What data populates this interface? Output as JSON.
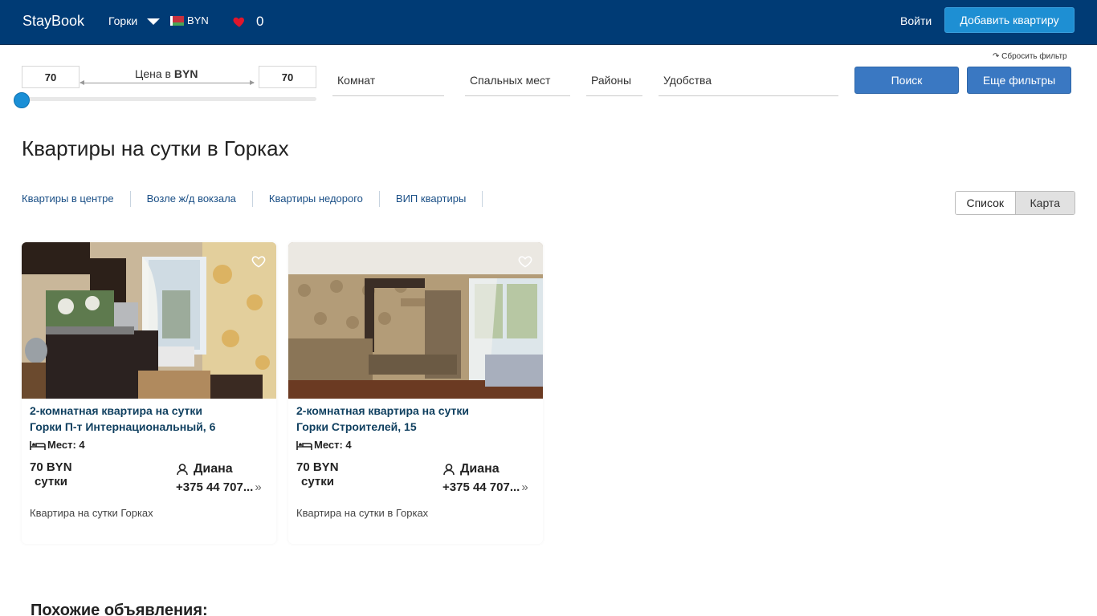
{
  "header": {
    "brand": "StayBook",
    "city": "Горки",
    "currency": "BYN",
    "favorites_count": "0",
    "login": "Войти",
    "add_button": "Добавить квартиру",
    "colors": {
      "bar": "#003b75",
      "accent": "#1e8fd3",
      "heart": "#e0162b"
    }
  },
  "filters": {
    "reset": "Сбросить фильтр",
    "price_min": "70",
    "price_max": "70",
    "price_label_prefix": "Цена в",
    "price_label_currency": "BYN",
    "slider_position": 0,
    "rooms": "Комнат",
    "beds": "Спальных мест",
    "districts": "Районы",
    "amenities": "Удобства",
    "search_button": "Поиск",
    "more_filters_button": "Еще фильтры"
  },
  "page": {
    "title": "Квартиры на сутки в Горках",
    "quick_links": [
      "Квартиры в центре",
      "Возле ж/д вокзала",
      "Квартиры недорого",
      "ВИП квартиры"
    ],
    "view_list": "Список",
    "view_map": "Карта",
    "similar_heading": "Похожие объявления:"
  },
  "listings": [
    {
      "title_line1": "2-комнатная квартира на сутки",
      "title_line2": "Горки П-т Интернациональный, 6",
      "beds": "Мест: 4",
      "price": "70 BYN",
      "per": "сутки",
      "owner": "Диана",
      "phone": "+375 44 707...",
      "description": "Квартира на сутки Горках",
      "photo_icon": "kitchen-photo"
    },
    {
      "title_line1": "2-комнатная квартира на сутки",
      "title_line2": "Горки Строителей, 15",
      "beds": "Мест: 4",
      "price": "70 BYN",
      "per": "сутки",
      "owner": "Диана",
      "phone": "+375 44 707...",
      "description": "Квартира на сутки в Горках",
      "photo_icon": "living-room-photo"
    }
  ]
}
